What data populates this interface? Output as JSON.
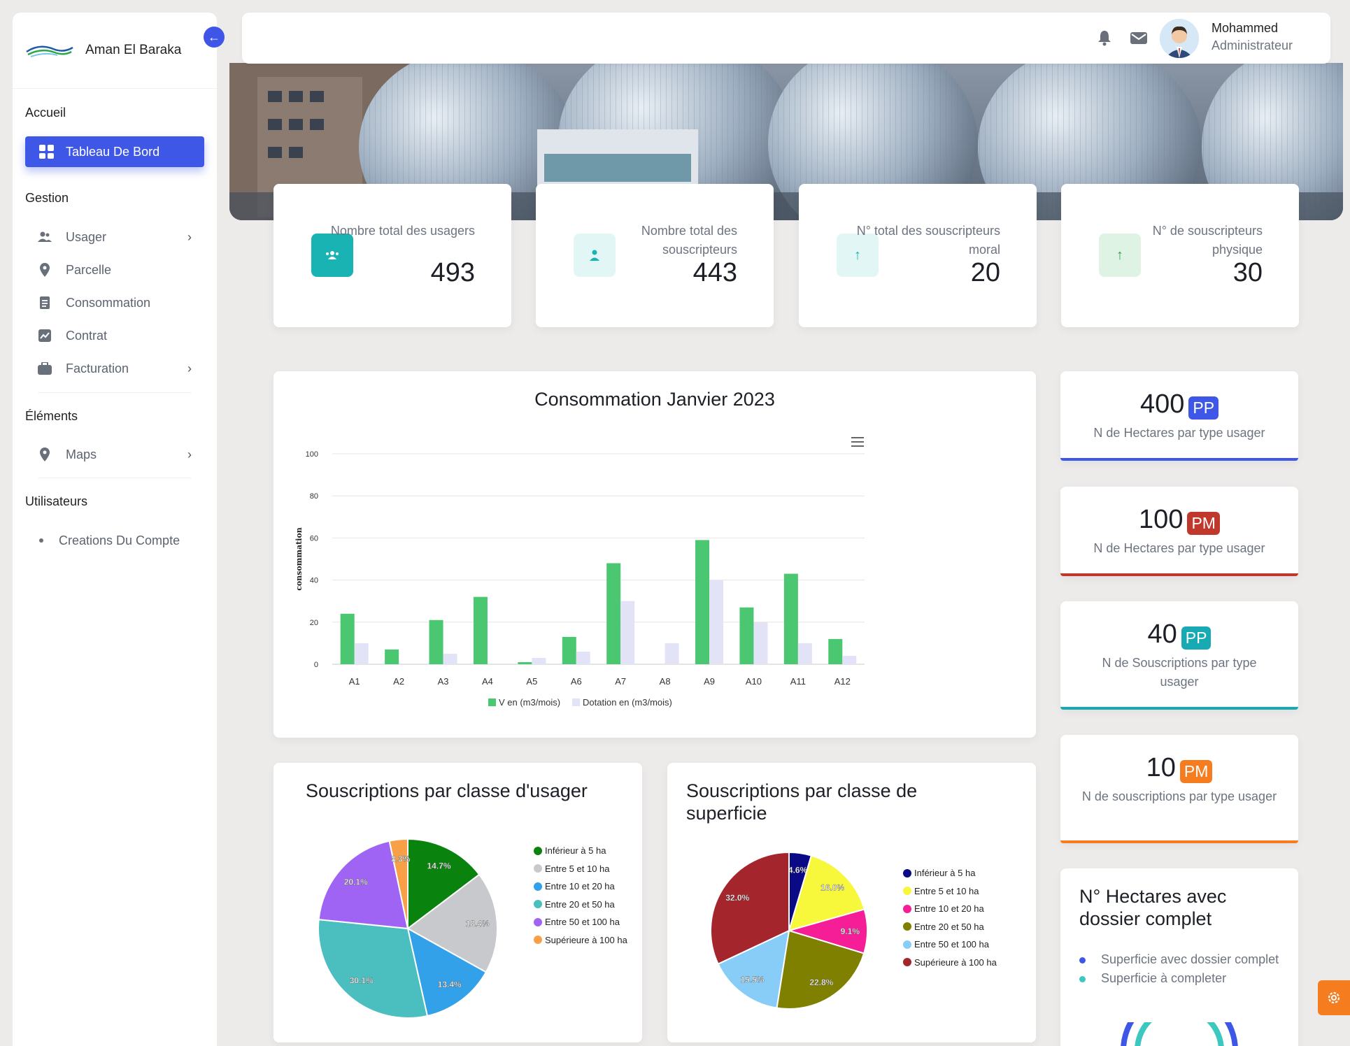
{
  "app": {
    "name": "Aman El Baraka"
  },
  "user": {
    "name": "Mohammed",
    "role": "Administrateur"
  },
  "sidebar": {
    "sections": [
      "Accueil",
      "Gestion",
      "Éléments",
      "Utilisateurs"
    ],
    "active": "Tableau De Bord",
    "gestion": [
      {
        "label": "Usager",
        "icon": "users-icon"
      },
      {
        "label": "Parcelle",
        "icon": "location-pin-icon"
      },
      {
        "label": "Consommation",
        "icon": "document-icon"
      },
      {
        "label": "Contrat",
        "icon": "chart-icon"
      },
      {
        "label": "Facturation",
        "icon": "briefcase-icon"
      }
    ],
    "elements": [
      {
        "label": "Maps",
        "icon": "location-pin-icon"
      }
    ],
    "utilisateurs": [
      {
        "label": "Creations Du Compte"
      }
    ]
  },
  "stats": [
    {
      "label": "Nombre total des usagers",
      "value": "493",
      "icon": "users-icon",
      "color": "#19b3b3"
    },
    {
      "label": "Nombre total des souscripteurs",
      "value": "443",
      "icon": "user-icon",
      "color": "#e3f6f6"
    },
    {
      "label": "N° total des souscripteurs moral",
      "value": "20",
      "icon": "arrow-up-icon",
      "color": "#e3f6f6"
    },
    {
      "label": "N° de souscripteurs physique",
      "value": "30",
      "icon": "arrow-up-icon",
      "color": "#dff3e5"
    }
  ],
  "kpis": [
    {
      "value": "400",
      "badge": "PP",
      "badge_color": "#3e57e6",
      "desc": "N de Hectares par type usager",
      "bar_color": "#3e57e6"
    },
    {
      "value": "100",
      "badge": "PM",
      "badge_color": "#c0382b",
      "desc": "N de Hectares par type usager",
      "bar_color": "#c0382b"
    },
    {
      "value": "40",
      "badge": "PP",
      "badge_color": "#17aab5",
      "desc": "N de Souscriptions par type usager",
      "bar_color": "#17aab5"
    },
    {
      "value": "10",
      "badge": "PM",
      "badge_color": "#f57c1f",
      "desc": "N de souscriptions par type usager",
      "bar_color": "#f57c1f"
    }
  ],
  "dossier": {
    "title": "N° Hectares avec dossier complet",
    "items": [
      {
        "label": "Superficie avec dossier complet",
        "color": "#3e57e6"
      },
      {
        "label": "Superficie à completer",
        "color": "#3cc7c0"
      }
    ]
  },
  "chart_data": [
    {
      "type": "bar",
      "title": "Consommation Janvier 2023",
      "ylabel": "consommation",
      "ylim": [
        0,
        100
      ],
      "yticks": [
        0,
        20,
        40,
        60,
        80,
        100
      ],
      "categories": [
        "A1",
        "A2",
        "A3",
        "A4",
        "A5",
        "A6",
        "A7",
        "A8",
        "A9",
        "A10",
        "A11",
        "A12"
      ],
      "series": [
        {
          "name": "V en (m3/mois)",
          "color": "#4cc771",
          "values": [
            24,
            7,
            21,
            32,
            1,
            13,
            48,
            0,
            59,
            27,
            43,
            12
          ]
        },
        {
          "name": "Dotation en (m3/mois)",
          "color": "#e3e3f7",
          "values": [
            10,
            0,
            5,
            0,
            3,
            6,
            30,
            10,
            40,
            20,
            10,
            4
          ]
        }
      ],
      "legend": "bottom"
    },
    {
      "type": "pie",
      "title": "Souscriptions par classe d'usager",
      "legend": "right",
      "slices": [
        {
          "label": "Inférieur à 5 ha",
          "value": 14.7,
          "color": "#0a820e"
        },
        {
          "label": "Entre 5 et 10 ha",
          "value": 18.4,
          "color": "#c7c9cc"
        },
        {
          "label": "Entre 10 et 20 ha",
          "value": 13.4,
          "color": "#33a0ea"
        },
        {
          "label": "Entre 20 et 50 ha",
          "value": 30.1,
          "color": "#4bbfbf"
        },
        {
          "label": "Entre 50 et 100 ha",
          "value": 20.1,
          "color": "#a064f5"
        },
        {
          "label": "Supérieure à 100 ha",
          "value": 3.3,
          "color": "#f8a048"
        }
      ]
    },
    {
      "type": "pie",
      "title": "Souscriptions par classe de superficie",
      "legend": "right",
      "slices": [
        {
          "label": "Inférieur à 5 ha",
          "value": 4.6,
          "color": "#0a0a86"
        },
        {
          "label": "Entre 5 et 10 ha",
          "value": 16.0,
          "color": "#f7f73c"
        },
        {
          "label": "Entre 10 et 20 ha",
          "value": 9.1,
          "color": "#f51e96"
        },
        {
          "label": "Entre 20 et 50 ha",
          "value": 22.8,
          "color": "#808000"
        },
        {
          "label": "Entre 50 et 100 ha",
          "value": 15.5,
          "color": "#87cdf7"
        },
        {
          "label": "Supérieure à 100 ha",
          "value": 32.0,
          "color": "#a5252c"
        }
      ]
    }
  ]
}
